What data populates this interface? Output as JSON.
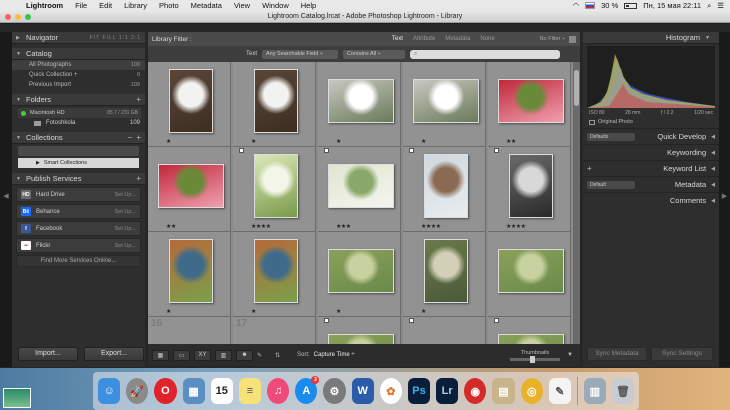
{
  "menubar": {
    "app_name": "Lightroom",
    "menus": [
      "File",
      "Edit",
      "Library",
      "Photo",
      "Metadata",
      "View",
      "Window",
      "Help"
    ],
    "battery": "30 %",
    "datetime": "Пн, 15 мая  22:11"
  },
  "window": {
    "title": "Lightroom Catalog.lrcat - Adobe Photoshop Lightroom - Library"
  },
  "left_panel": {
    "navigator": {
      "label": "Navigator",
      "zoom_opts": "FIT  FILL  1:1  3:1"
    },
    "catalog": {
      "label": "Catalog",
      "items": [
        {
          "label": "All Photographs",
          "count": "109"
        },
        {
          "label": "Quick Collection +",
          "count": "0"
        },
        {
          "label": "Previous Import",
          "count": "109"
        }
      ]
    },
    "folders": {
      "label": "Folders",
      "drive": {
        "label": "Macintosh HD",
        "space": "85.7 / 231 GB"
      },
      "folder": {
        "label": "Fotoshkola",
        "count": "109"
      }
    },
    "collections": {
      "label": "Collections",
      "smart": "Smart Collections"
    },
    "publish": {
      "label": "Publish Services",
      "services": [
        {
          "label": "Hard Drive",
          "action": "Set Up...",
          "logo": "HD",
          "color": "#6b6b6b"
        },
        {
          "label": "Behance",
          "action": "Set Up...",
          "logo": "Bē",
          "color": "#1769ff"
        },
        {
          "label": "Facebook",
          "action": "Set Up...",
          "logo": "f",
          "color": "#3b5998"
        },
        {
          "label": "Flickr",
          "action": "Set Up...",
          "logo": "••",
          "color": "#ffffff"
        }
      ],
      "find_more": "Find More Services Online..."
    },
    "import_label": "Import...",
    "export_label": "Export..."
  },
  "filter": {
    "label": "Library Filter :",
    "tabs": [
      "Text",
      "Attribute",
      "Metadata",
      "None"
    ],
    "active_tab": "Text",
    "status": "No Filter ÷",
    "text_label": "Text",
    "field": "Any Searchable Field ÷",
    "rule": "Contains All ÷"
  },
  "grid_cells": [
    {
      "row": 0,
      "col": 0,
      "idx": "",
      "stars": "★",
      "flag": false,
      "palette": "orchid-vase",
      "tall": true
    },
    {
      "row": 0,
      "col": 1,
      "idx": "",
      "stars": "★",
      "flag": false,
      "palette": "orchid-vase",
      "tall": true
    },
    {
      "row": 0,
      "col": 2,
      "idx": "",
      "stars": "★",
      "flag": false,
      "palette": "orchid-white",
      "tall": false
    },
    {
      "row": 0,
      "col": 3,
      "idx": "",
      "stars": "★",
      "flag": false,
      "palette": "orchid-white",
      "tall": false
    },
    {
      "row": 0,
      "col": 4,
      "idx": "",
      "stars": "★★",
      "flag": false,
      "palette": "red-blossom",
      "tall": false
    },
    {
      "row": 1,
      "col": 0,
      "idx": "",
      "stars": "★★",
      "flag": false,
      "palette": "red-blossom",
      "tall": false
    },
    {
      "row": 1,
      "col": 1,
      "idx": "",
      "stars": "★★★★",
      "flag": true,
      "palette": "white-tree",
      "tall": true
    },
    {
      "row": 1,
      "col": 2,
      "idx": "",
      "stars": "★★★",
      "flag": true,
      "palette": "spring-branch",
      "tall": false
    },
    {
      "row": 1,
      "col": 3,
      "idx": "",
      "stars": "★★★★",
      "flag": true,
      "palette": "eiffel",
      "tall": true
    },
    {
      "row": 1,
      "col": 4,
      "idx": "",
      "stars": "★★★★",
      "flag": true,
      "palette": "bw-street",
      "tall": true
    },
    {
      "row": 2,
      "col": 0,
      "idx": "",
      "stars": "★",
      "flag": false,
      "palette": "tennis",
      "tall": true
    },
    {
      "row": 2,
      "col": 1,
      "idx": "",
      "stars": "★",
      "flag": false,
      "palette": "tennis",
      "tall": true
    },
    {
      "row": 2,
      "col": 2,
      "idx": "",
      "stars": "★",
      "flag": false,
      "palette": "park",
      "tall": false
    },
    {
      "row": 2,
      "col": 3,
      "idx": "",
      "stars": "★",
      "flag": false,
      "palette": "forest-path",
      "tall": true
    },
    {
      "row": 2,
      "col": 4,
      "idx": "",
      "stars": "",
      "flag": false,
      "palette": "park",
      "tall": false
    },
    {
      "row": 3,
      "col": 0,
      "idx": "16",
      "stars": "",
      "flag": false,
      "palette": "none",
      "tall": false
    },
    {
      "row": 3,
      "col": 1,
      "idx": "17",
      "stars": "",
      "flag": false,
      "palette": "none",
      "tall": false
    },
    {
      "row": 3,
      "col": 2,
      "idx": "",
      "stars": "",
      "flag": true,
      "palette": "park",
      "tall": false
    },
    {
      "row": 3,
      "col": 3,
      "idx": "",
      "stars": "",
      "flag": true,
      "palette": "none",
      "tall": false
    },
    {
      "row": 3,
      "col": 4,
      "idx": "",
      "stars": "",
      "flag": true,
      "palette": "park",
      "tall": false
    }
  ],
  "palettes": {
    "orchid-vase": [
      "#5a4638",
      "#f2f2f0",
      "#3d2e22"
    ],
    "orchid-white": [
      "#c8c8c0",
      "#ffffff",
      "#6a7a5a"
    ],
    "red-blossom": [
      "#c0283a",
      "#6a8a3a",
      "#f0a0b0"
    ],
    "white-tree": [
      "#d8e8b8",
      "#f4f6ea",
      "#7a9a4a"
    ],
    "spring-branch": [
      "#dfe6cf",
      "#8aa86a",
      "#f5f5f0"
    ],
    "eiffel": [
      "#cfd8e0",
      "#8a6a52",
      "#e8ecef"
    ],
    "bw-street": [
      "#6a6a6a",
      "#d8d8d8",
      "#2a2a2a"
    ],
    "tennis": [
      "#b56a3a",
      "#3f6a8a",
      "#7aa04a"
    ],
    "park": [
      "#8aa05a",
      "#c8d2a0",
      "#6a8a4a"
    ],
    "forest-path": [
      "#6a7a4a",
      "#d4d0b8",
      "#4a5a3a"
    ],
    "none": [
      "#929292",
      "#929292",
      "#929292"
    ]
  },
  "right_panel": {
    "histogram": {
      "label": "Histogram",
      "iso": "ISO 80",
      "focal": "28 mm",
      "aperture": "f / 2.2",
      "shutter": "1/20 sec",
      "original": "Original Photo"
    },
    "quick_develop": {
      "label": "Quick Develop",
      "preset": "Defaults"
    },
    "keywording": {
      "label": "Keywording"
    },
    "keyword_list": {
      "label": "Keyword List"
    },
    "metadata": {
      "label": "Metadata",
      "preset": "Default"
    },
    "comments": {
      "label": "Comments"
    },
    "sync_metadata": "Sync Metadata",
    "sync_settings": "Sync Settings"
  },
  "toolbar": {
    "sort_label": "Sort:",
    "sort_value": "Capture Time ÷",
    "thumbnails_label": "Thumbnails"
  },
  "dock": [
    {
      "name": "finder-icon",
      "bg": "#3d8fe0",
      "glyph": "☺"
    },
    {
      "name": "launchpad-icon",
      "bg": "#8a8a8a",
      "glyph": "🚀",
      "circle": true
    },
    {
      "name": "opera-icon",
      "bg": "#e0222a",
      "glyph": "O",
      "circle": true
    },
    {
      "name": "preview-icon",
      "bg": "#5b8fc2",
      "glyph": "▦"
    },
    {
      "name": "calendar-icon",
      "bg": "#ffffff",
      "glyph": "15",
      "fg": "#222"
    },
    {
      "name": "notes-icon",
      "bg": "#f7e27a",
      "glyph": "≡",
      "fg": "#555"
    },
    {
      "name": "itunes-icon",
      "bg": "#f04a7a",
      "glyph": "♫",
      "circle": true
    },
    {
      "name": "app-store-icon",
      "bg": "#1a8cf0",
      "glyph": "A",
      "circle": true,
      "badge": "3"
    },
    {
      "name": "system-prefs-icon",
      "bg": "#7a7a7a",
      "glyph": "⚙",
      "circle": true
    },
    {
      "name": "word-icon",
      "bg": "#2a5caa",
      "glyph": "W"
    },
    {
      "name": "photos-icon",
      "bg": "#ffffff",
      "glyph": "✿",
      "fg": "#e07a2a",
      "circle": true
    },
    {
      "name": "photoshop-icon",
      "bg": "#0a1e3a",
      "glyph": "Ps",
      "fg": "#3ab0f0"
    },
    {
      "name": "lightroom-icon",
      "bg": "#0a1e3a",
      "glyph": "Lr",
      "fg": "#aacff0"
    },
    {
      "name": "photo-booth-icon",
      "bg": "#d42a2a",
      "glyph": "◉",
      "circle": true
    },
    {
      "name": "contacts-icon",
      "bg": "#c9b38a",
      "glyph": "▤"
    },
    {
      "name": "chrome-icon",
      "bg": "#e8b22a",
      "glyph": "◎",
      "circle": true
    },
    {
      "name": "textedit-icon",
      "bg": "#f4f4f4",
      "glyph": "✎",
      "fg": "#555"
    },
    {
      "name": "downloads-icon",
      "bg": "#9aaab8",
      "glyph": "▥"
    },
    {
      "name": "trash-icon",
      "bg": "#c8ccd0",
      "glyph": "🗑",
      "fg": "#555"
    }
  ]
}
